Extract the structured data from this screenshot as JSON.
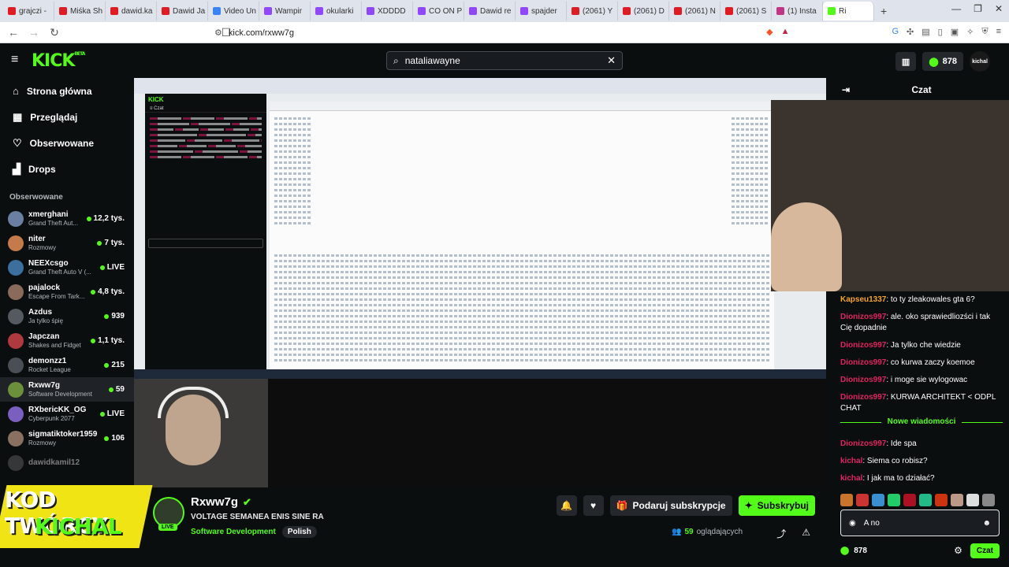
{
  "browser": {
    "tabs": [
      {
        "label": "grajczi -",
        "color": "#e01b24"
      },
      {
        "label": "Miśka Sh",
        "color": "#e01b24"
      },
      {
        "label": "dawid.ka",
        "color": "#e01b24"
      },
      {
        "label": "Dawid Ja",
        "color": "#e01b24"
      },
      {
        "label": "Video Un",
        "color": "#3b82f6"
      },
      {
        "label": "Wampir",
        "color": "#9146ff"
      },
      {
        "label": "okularki",
        "color": "#9146ff"
      },
      {
        "label": "XDDDD",
        "color": "#9146ff"
      },
      {
        "label": "CO ON P",
        "color": "#9146ff"
      },
      {
        "label": "Dawid re",
        "color": "#9146ff"
      },
      {
        "label": "spajder",
        "color": "#9146ff"
      },
      {
        "label": "(2061) Y",
        "color": "#e01b24"
      },
      {
        "label": "(2061) D",
        "color": "#e01b24"
      },
      {
        "label": "(2061) N",
        "color": "#e01b24"
      },
      {
        "label": "(2061) S",
        "color": "#e01b24"
      },
      {
        "label": "(1) Insta",
        "color": "#c13584"
      },
      {
        "label": "Ri",
        "color": "#53fc18",
        "active": true
      }
    ],
    "url": "kick.com/rxww7g"
  },
  "header": {
    "search_value": "nataliawayne",
    "points": "878",
    "user": "kichal"
  },
  "sidebar": {
    "nav": [
      {
        "label": "Strona główna",
        "icon": "home-icon"
      },
      {
        "label": "Przeglądaj",
        "icon": "browse-icon"
      },
      {
        "label": "Obserwowane",
        "icon": "heart-icon"
      },
      {
        "label": "Drops",
        "icon": "drops-icon"
      }
    ],
    "followed_title": "Obserwowane",
    "followed": [
      {
        "name": "xmerghani",
        "category": "Grand Theft Aut...",
        "viewers": "12,2 tys.",
        "color": "#6b7fa3"
      },
      {
        "name": "niter",
        "category": "Rozmowy",
        "viewers": "7 tys.",
        "color": "#c47a4a"
      },
      {
        "name": "NEEXcsgo",
        "category": "Grand Theft Auto V (...",
        "viewers": "LIVE",
        "color": "#3c6e9e"
      },
      {
        "name": "pajalock",
        "category": "Escape From Tark...",
        "viewers": "4,8 tys.",
        "color": "#8a6a5a"
      },
      {
        "name": "Azdus",
        "category": "Ja tylko śpię",
        "viewers": "939",
        "color": "#555a60"
      },
      {
        "name": "Japczan",
        "category": "Shakes and Fidget",
        "viewers": "1,1 tys.",
        "color": "#b0383f"
      },
      {
        "name": "demonzz1",
        "category": "Rocket League",
        "viewers": "215",
        "color": "#4a4f55"
      },
      {
        "name": "Rxww7g",
        "category": "Software Development",
        "viewers": "59",
        "color": "#6b8f3a",
        "active": true
      },
      {
        "name": "RXbericKK_OG",
        "category": "Cyberpunk 2077",
        "viewers": "LIVE",
        "color": "#7a5fc0"
      },
      {
        "name": "sigmatiktoker1959",
        "category": "Rozmowy",
        "viewers": "106",
        "color": "#8a7060"
      },
      {
        "name": "dawidkamil12",
        "category": "",
        "viewers": "",
        "color": "#6a6a6a",
        "offline": true
      }
    ]
  },
  "stream": {
    "name": "Rxww7g",
    "title": "VOLTAGE SEMANEA ENIS SINE RA",
    "category": "Software Development",
    "tag": "Polish",
    "live_label": "LIVE",
    "gift_label": "Podaruj subskrypcje",
    "subscribe_label": "Subskrybuj",
    "viewers": "59",
    "viewers_label": "oglądających"
  },
  "promo": {
    "line1": "KOD TWÓRCY",
    "line2": "KICHAL"
  },
  "chat": {
    "title": "Czat",
    "messages": [
      {
        "user": "Kapseu1337",
        "color": "#f5a623",
        "text": ": to ty zleakowales gta 6?"
      },
      {
        "user": "Dionizos997",
        "color": "#e0245e",
        "text": ": ale. oko sprawiedliozści i tak Cię dopadnie"
      },
      {
        "user": "Dionizos997",
        "color": "#e0245e",
        "text": ": Ja tylko che wiedzie"
      },
      {
        "user": "Dionizos997",
        "color": "#e0245e",
        "text": ": co kurwa zaczy koemoe"
      },
      {
        "user": "Dionizos997",
        "color": "#e0245e",
        "text": ": i moge sie wylogowac"
      },
      {
        "user": "Dionizos997",
        "color": "#e0245e",
        "text": ": KURWA ARCHITEKT < ODPL CHAT"
      }
    ],
    "new_messages_label": "Nowe wiadomości",
    "new_messages": [
      {
        "user": "Dionizos997",
        "color": "#e0245e",
        "text": ": Ide spa"
      },
      {
        "user": "kichal",
        "color": "#e0245e",
        "text": ": Siema co robisz?"
      },
      {
        "user": "kichal",
        "color": "#e0245e",
        "text": ": I jak ma to działać?"
      }
    ],
    "input_value": "A no",
    "points": "878",
    "send_label": "Czat"
  }
}
